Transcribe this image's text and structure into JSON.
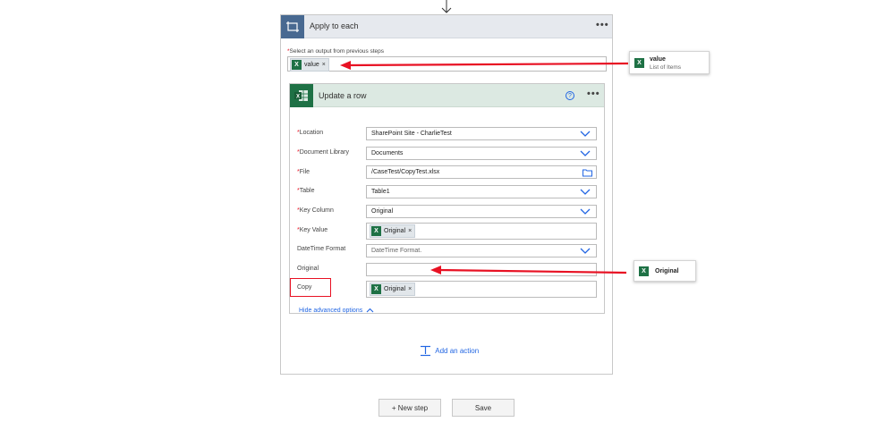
{
  "apply_to_each": {
    "title": "Apply to each",
    "more": "•••",
    "select_label": "Select an output from previous steps",
    "required_mark": "*",
    "token_value": "value",
    "token_close": "×"
  },
  "update_row": {
    "title": "Update a row",
    "help": "?",
    "more": "•••",
    "fields": [
      {
        "label": "Location",
        "required": true,
        "value": "SharePoint Site - CharlieTest",
        "control": "dropdown"
      },
      {
        "label": "Document Library",
        "required": true,
        "value": "Documents",
        "control": "dropdown"
      },
      {
        "label": "File",
        "required": true,
        "value": "/CaseTest/CopyTest.xlsx",
        "control": "file"
      },
      {
        "label": "Table",
        "required": true,
        "value": "Table1",
        "control": "dropdown"
      },
      {
        "label": "Key Column",
        "required": true,
        "value": "Original",
        "control": "dropdown"
      },
      {
        "label": "Key Value",
        "required": true,
        "token": "Original",
        "control": "token"
      },
      {
        "label": "DateTime Format",
        "required": false,
        "placeholder": "DateTime Format.",
        "control": "dropdown"
      },
      {
        "label": "Original",
        "required": false,
        "value": "",
        "control": "text"
      },
      {
        "label": "Copy",
        "required": false,
        "token": "Original",
        "control": "token"
      }
    ],
    "advanced_toggle": "Hide advanced options",
    "token_close": "×"
  },
  "add_action": "Add an action",
  "buttons": {
    "new_step": "+ New step",
    "save": "Save"
  },
  "dynamic_cards": {
    "value_card": {
      "title": "value",
      "subtitle": "List of Items"
    },
    "original_card": {
      "title": "Original"
    }
  },
  "colors": {
    "excel_green": "#1e7145",
    "loop_blue": "#486991",
    "link_blue": "#2266e3",
    "annotation_red": "#e81123"
  },
  "icons": {
    "excel": "excel-icon",
    "loop": "loop-icon",
    "chevron": "chevron-down-icon",
    "folder": "folder-icon",
    "add_action": "add-action-icon",
    "help": "help-icon"
  }
}
